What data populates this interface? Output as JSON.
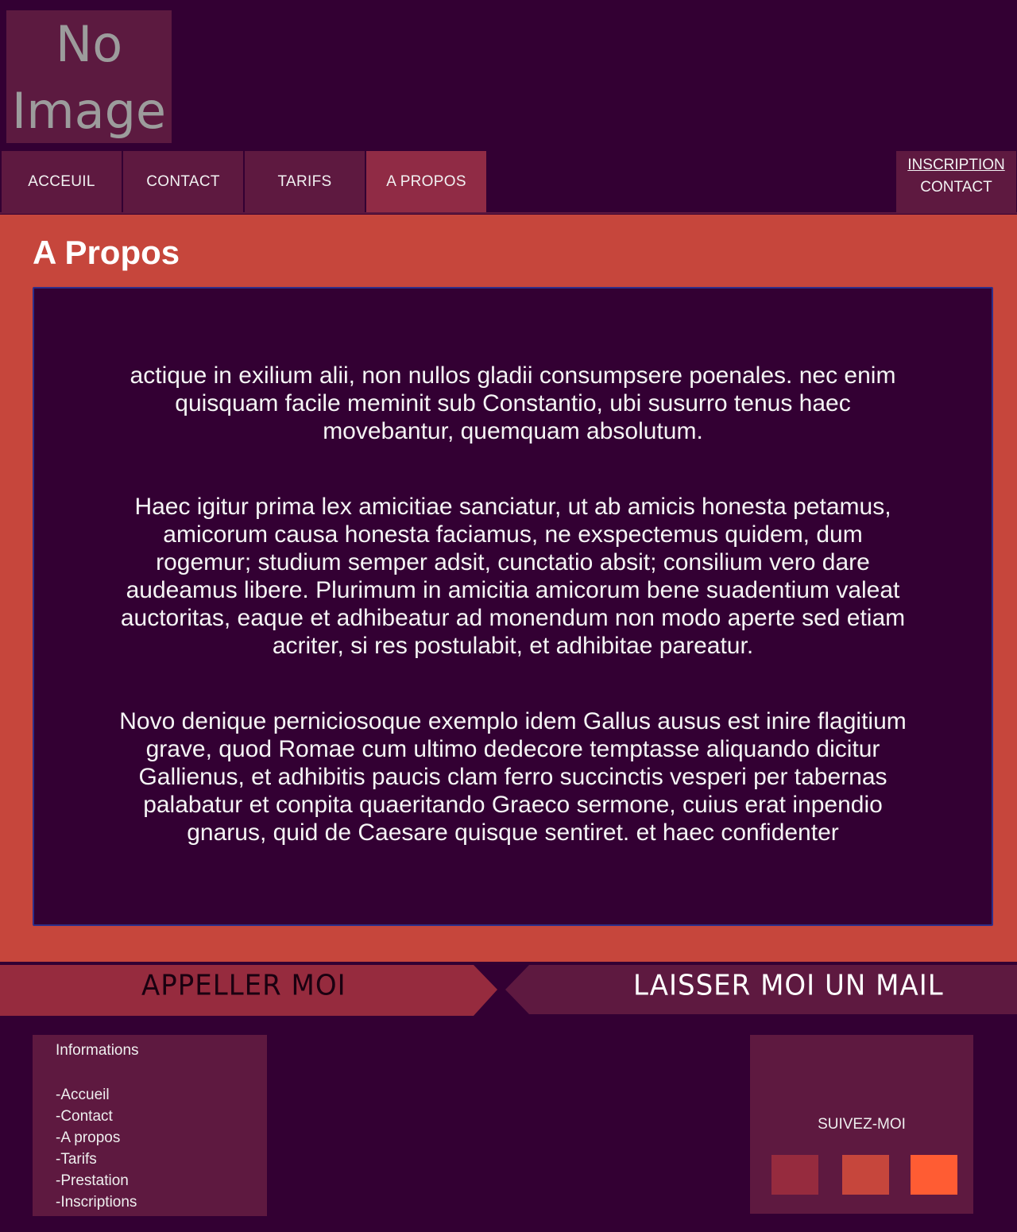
{
  "header": {
    "logo_text_line1": "No",
    "logo_text_line2": "Image"
  },
  "nav": {
    "items": [
      {
        "label": "ACCEUIL",
        "active": false
      },
      {
        "label": "CONTACT",
        "active": false
      },
      {
        "label": "TARIFS",
        "active": false
      },
      {
        "label": "A PROPOS",
        "active": true
      }
    ],
    "right": {
      "inscription": "INSCRIPTION",
      "contact": "CONTACT"
    }
  },
  "main": {
    "title": "A Propos",
    "paragraphs": [
      "actique in exilium alii, non nullos gladii consumpsere poenales. nec enim quisquam facile meminit sub Constantio, ubi susurro tenus haec movebantur, quemquam absolutum.",
      "Haec igitur prima lex amicitiae sanciatur, ut ab amicis honesta petamus, amicorum causa honesta faciamus, ne exspectemus quidem, dum rogemur; studium semper adsit, cunctatio absit; consilium vero dare audeamus libere. Plurimum in amicitia amicorum bene suadentium valeat auctoritas, eaque et adhibeatur ad monendum non modo aperte sed etiam acriter, si res postulabit, et adhibitae pareatur.",
      "Novo denique perniciosoque exemplo idem Gallus ausus est inire flagitium grave, quod Romae cum ultimo dedecore temptasse aliquando dicitur Gallienus, et adhibitis paucis clam ferro succinctis vesperi per tabernas palabatur et conpita quaeritando Graeco sermone, cuius erat inpendio gnarus, quid de Caesare quisque sentiret. et haec confidenter"
    ]
  },
  "cta": {
    "call_label": "APPELLER MOI",
    "mail_label": "LAISSER MOI UN MAIL"
  },
  "footer": {
    "info_title": "Informations",
    "links": [
      "-Accueil",
      "-Contact",
      "-A propos",
      "-Tarifs",
      "-Prestation",
      "-Inscriptions"
    ],
    "follow_label": "SUIVEZ-MOI",
    "social_colors": [
      "#962b3e",
      "#c6463c",
      "#ff5c33"
    ]
  },
  "colors": {
    "background": "#330033",
    "nav_item": "#5e1940",
    "nav_active": "#902b45",
    "main_bg": "#c6463c",
    "accent": "#ff5c33"
  }
}
